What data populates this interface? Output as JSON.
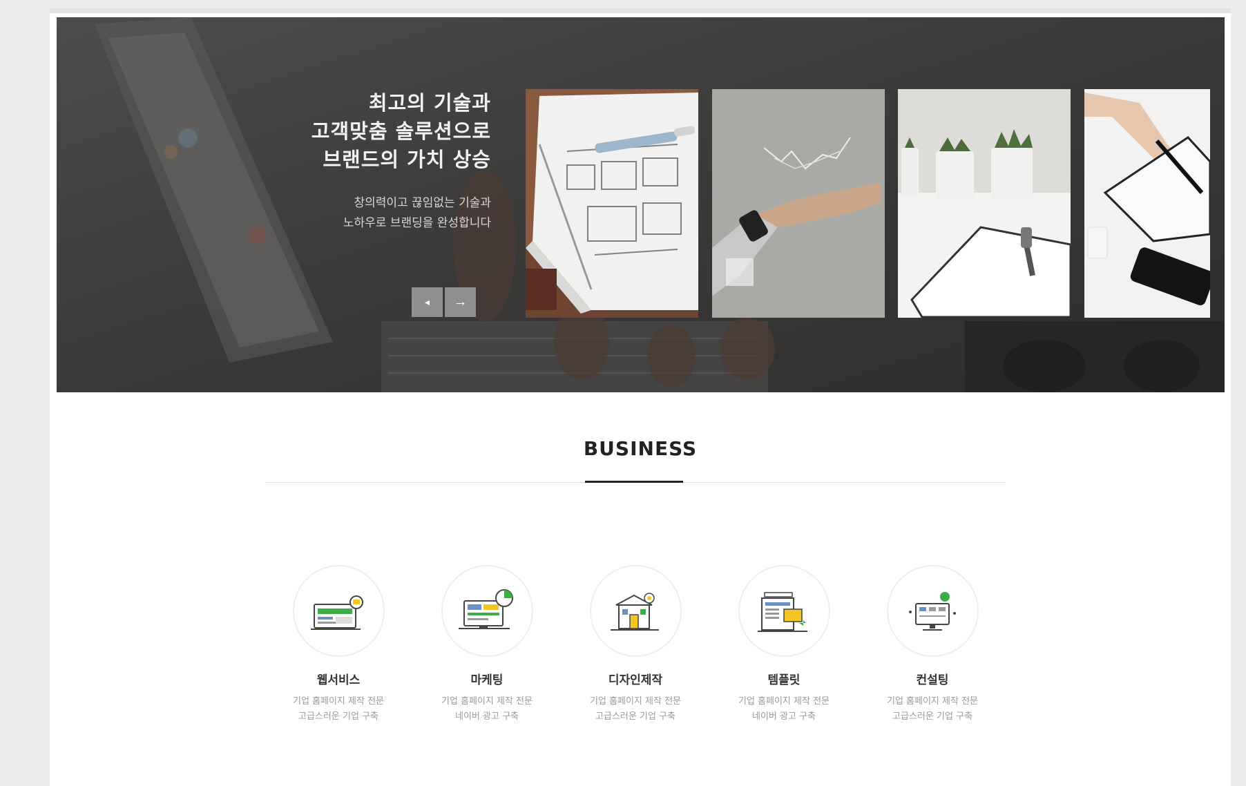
{
  "hero": {
    "title": "최고의 기술과\n고객맞춤 솔루션으로\n브랜드의 가치 상승",
    "description": "창의력이고 끊임없는 기술과\n노하우로 브랜딩을 완성합니다",
    "prev_icon": "prev-arrow-icon",
    "next_icon": "next-arrow-icon",
    "prev_glyph": "◂",
    "next_glyph": "→"
  },
  "business": {
    "title": "BUSINESS",
    "services": [
      {
        "name": "웹서비스",
        "description": "기업 홈페이지 제작 전문\n고급스러운 기업 구축",
        "icon": "web-service-icon"
      },
      {
        "name": "마케팅",
        "description": "기업 홈페이지 제작 전문\n네이버 광고 구축",
        "icon": "marketing-icon"
      },
      {
        "name": "디자인제작",
        "description": "기업 홈페이지 제작 전문\n고급스러운 기업 구축",
        "icon": "design-icon"
      },
      {
        "name": "템플릿",
        "description": "기업 홈페이지 제작 전문\n네이버 광고 구축",
        "icon": "template-icon"
      },
      {
        "name": "컨설팅",
        "description": "기업 홈페이지 제작 전문\n고급스러운 기업 구축",
        "icon": "consulting-icon"
      }
    ]
  },
  "colors": {
    "accent_green": "#3cae48",
    "accent_yellow": "#f3c623",
    "hero_bg": "#3c3b3a"
  }
}
